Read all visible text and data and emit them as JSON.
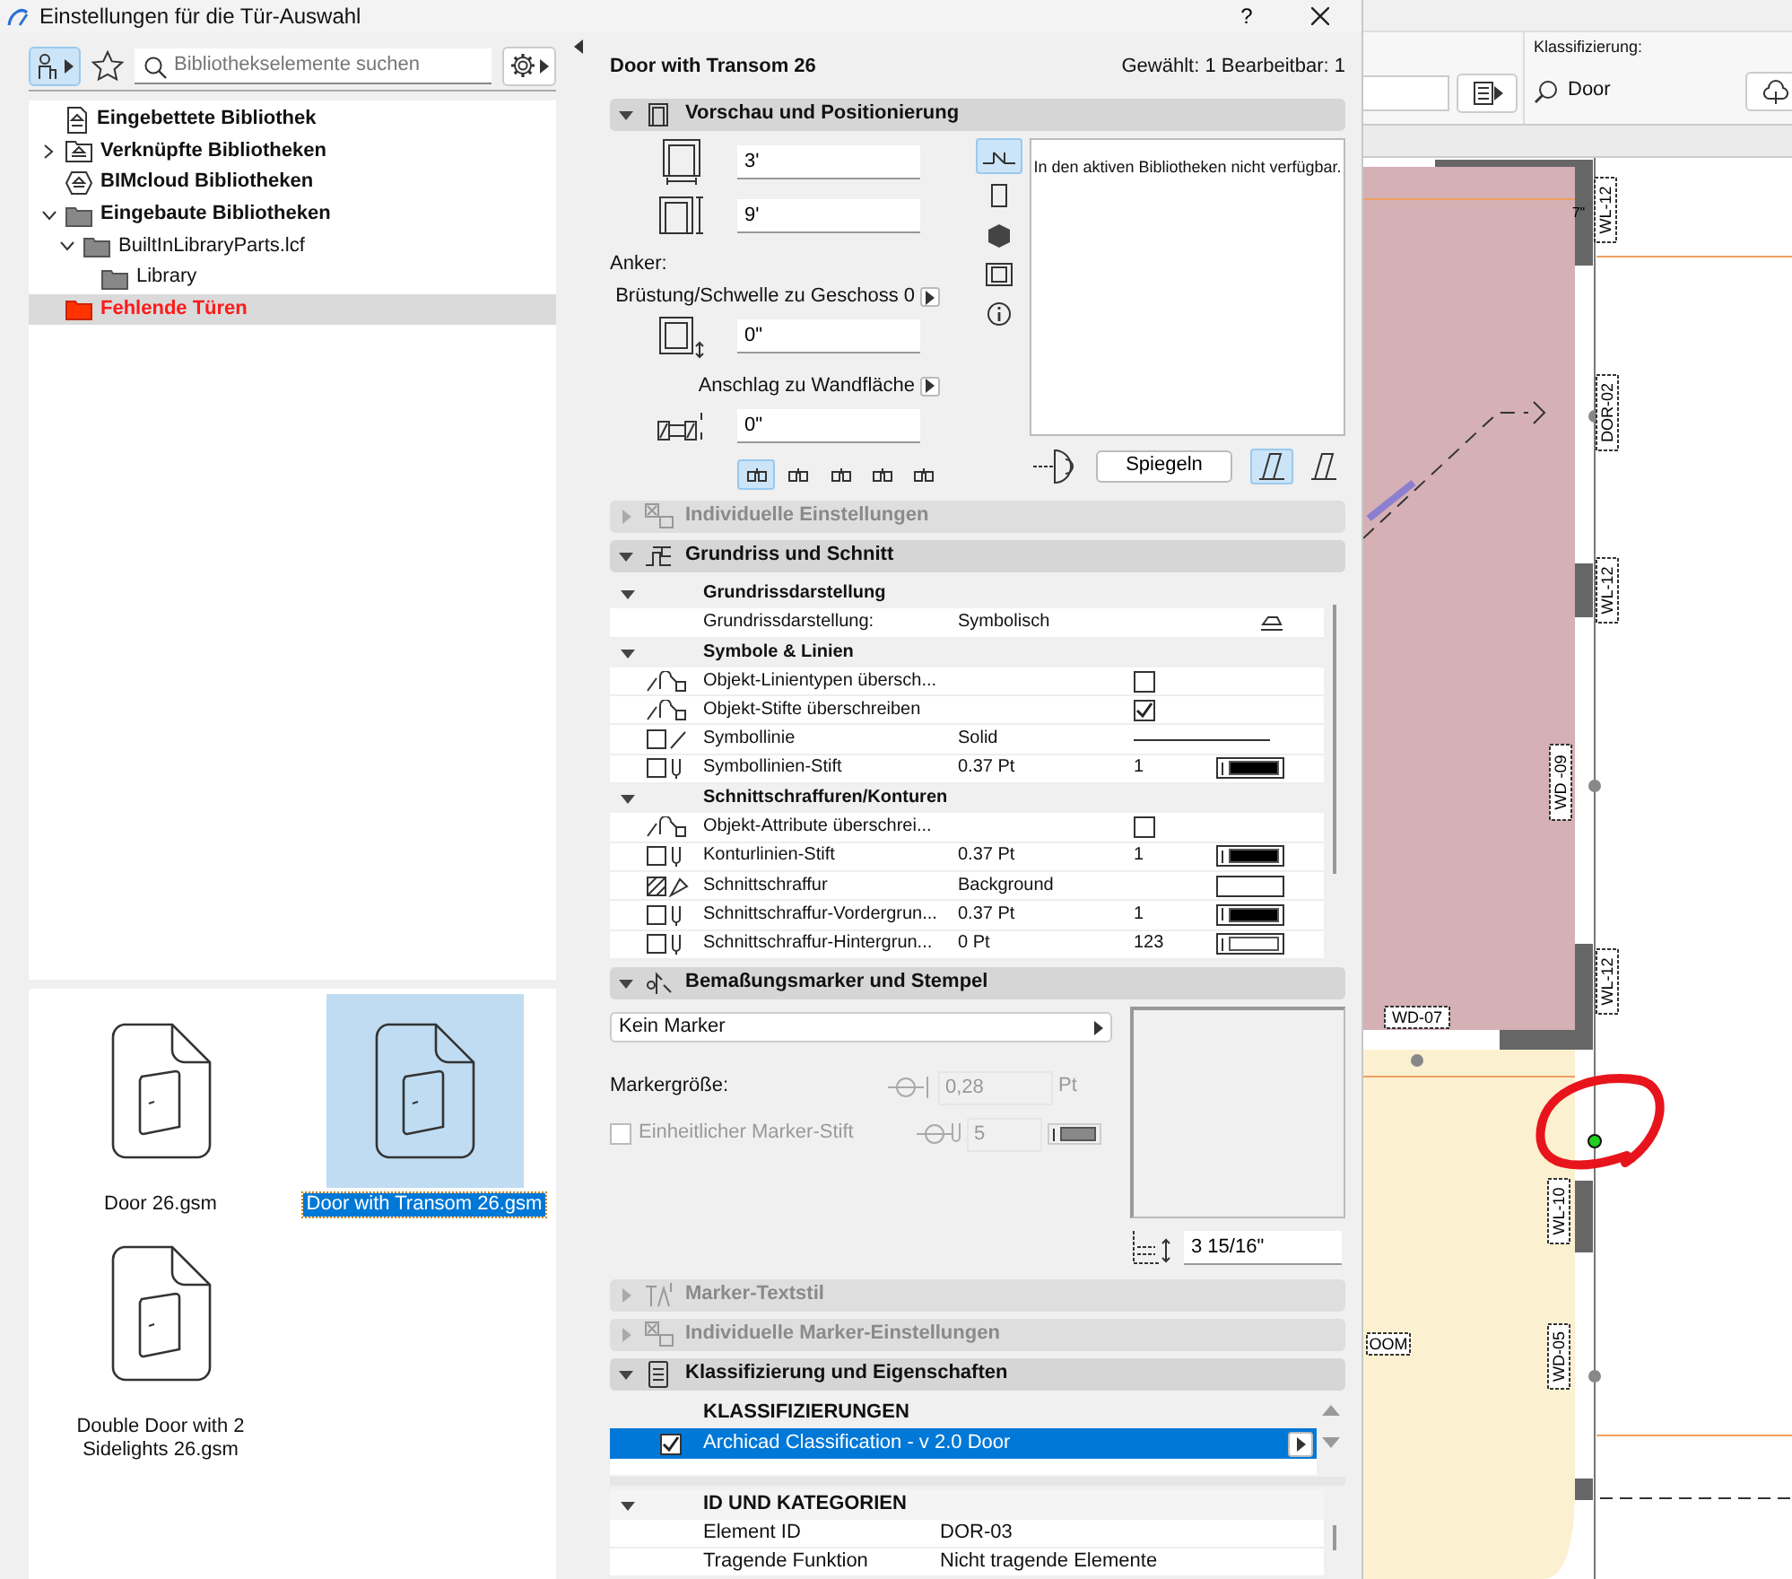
{
  "window": {
    "title": "Einstellungen für die Tür-Auswahl",
    "help": "?"
  },
  "library": {
    "type_button": {
      "active": true
    },
    "search": {
      "placeholder": "Bibliothekselemente suchen"
    },
    "tree": [
      {
        "label": "Eingebettete Bibliothek",
        "kind": "embedded",
        "selected": false
      },
      {
        "label": "Verknüpfte Bibliotheken",
        "kind": "linked",
        "expanded": false,
        "selected": false
      },
      {
        "label": "BIMcloud Bibliotheken",
        "kind": "bimcloud",
        "selected": false
      },
      {
        "label": "Eingebaute Bibliotheken",
        "kind": "folder",
        "expanded": true,
        "selected": false,
        "children": [
          {
            "label": "BuiltInLibraryParts.lcf",
            "kind": "folder",
            "expanded": true,
            "selected": false,
            "children": [
              {
                "label": "Library",
                "kind": "folder",
                "selected": false
              }
            ]
          }
        ]
      },
      {
        "label": "Fehlende Türen",
        "kind": "missing",
        "selected": true
      }
    ],
    "files": [
      {
        "name": "Door 26.gsm",
        "selected": false
      },
      {
        "name": "Door with Transom 26.gsm",
        "selected": true
      },
      {
        "name": "Double Door with 2 Sidelights 26.gsm",
        "selected": false
      }
    ]
  },
  "settings": {
    "element_name": "Door with Transom 26",
    "selection_info": "Gewählt: 1 Bearbeitbar: 1",
    "sections": [
      {
        "kind": "preview",
        "title": "Vorschau und Positionierung",
        "expanded": true,
        "disabled": false,
        "width": "3'",
        "height": "9'",
        "anchor_label": "Anker:",
        "sill_label": "Brüstung/Schwelle zu Geschoss 0",
        "sill_value": "0\"",
        "reveal_label": "Anschlag zu Wandfläche",
        "reveal_value": "0\"",
        "anchors": [
          {
            "selected": true
          },
          {
            "selected": false
          },
          {
            "selected": false
          },
          {
            "selected": false
          },
          {
            "selected": false
          }
        ],
        "views": [
          {
            "selected": true
          },
          {
            "selected": false
          },
          {
            "selected": false
          },
          {
            "selected": false
          },
          {
            "selected": false
          }
        ],
        "preview_message": "In den aktiven Bibliotheken nicht verfügbar.",
        "mirror_button": "Spiegeln",
        "sides": [
          {
            "selected": true
          },
          {
            "selected": false
          }
        ]
      },
      {
        "kind": "plain",
        "title": "Individuelle Einstellungen",
        "expanded": false,
        "disabled": true
      },
      {
        "kind": "table",
        "title": "Grundriss und Schnitt",
        "expanded": true,
        "disabled": false,
        "rows": [
          {
            "kind": "group",
            "label": "Grundrissdarstellung",
            "expanded": true
          },
          {
            "kind": "option",
            "label": "Grundrissdarstellung:",
            "value": "Symbolisch"
          },
          {
            "kind": "group",
            "label": "Symbole & Linien",
            "expanded": true
          },
          {
            "kind": "checkbox",
            "label": "Objekt-Linientypen übersch...",
            "checked": false
          },
          {
            "kind": "checkbox",
            "label": "Objekt-Stifte überschreiben",
            "checked": true
          },
          {
            "kind": "line",
            "label": "Symbollinie",
            "value": "Solid"
          },
          {
            "kind": "pen",
            "label": "Symbollinien-Stift",
            "value": "0.37 Pt",
            "pen": "1",
            "color": "#000000"
          },
          {
            "kind": "group",
            "label": "Schnittschraffuren/Konturen",
            "expanded": true
          },
          {
            "kind": "checkbox",
            "label": "Objekt-Attribute überschrei...",
            "checked": false
          },
          {
            "kind": "pen",
            "label": "Konturlinien-Stift",
            "value": "0.37 Pt",
            "pen": "1",
            "color": "#000000"
          },
          {
            "kind": "fill",
            "label": "Schnittschraffur",
            "value": "Background"
          },
          {
            "kind": "pen",
            "label": "Schnittschraffur-Vordergrun...",
            "value": "0.37 Pt",
            "pen": "1",
            "color": "#000000"
          },
          {
            "kind": "pen",
            "label": "Schnittschraffur-Hintergrun...",
            "value": "0 Pt",
            "pen": "123",
            "color": "#ffffff"
          }
        ]
      },
      {
        "kind": "marker",
        "title": "Bemaßungsmarker und Stempel",
        "expanded": true,
        "disabled": false,
        "marker_type": "Kein Marker",
        "size_label": "Markergröße:",
        "size_value": "0,28",
        "size_unit": "Pt",
        "pen_label": "Einheitlicher Marker-Stift",
        "pen_checked": false,
        "pen_disabled": true,
        "pen_value": "5",
        "offset_value": "3 15/16\""
      },
      {
        "kind": "plain",
        "title": "Marker-Textstil",
        "expanded": false,
        "disabled": true
      },
      {
        "kind": "plain",
        "title": "Individuelle Marker-Einstellungen",
        "expanded": false,
        "disabled": true
      },
      {
        "kind": "classification",
        "title": "Klassifizierung und Eigenschaften",
        "expanded": true,
        "disabled": false,
        "heading": "KLASSIFIZIERUNGEN",
        "classifications": [
          {
            "label": "Archicad Classification - v 2.0 Door",
            "checked": true,
            "selected": true
          }
        ],
        "groups": [
          {
            "label": "ID UND KATEGORIEN",
            "expanded": true,
            "rows": [
              {
                "label": "Element ID",
                "value": "DOR-03"
              },
              {
                "label": "Tragende Funktion",
                "value": "Nicht tragende Elemente"
              }
            ]
          }
        ]
      }
    ]
  },
  "plan": {
    "toolbar": {
      "classification_label": "Klassifizierung:",
      "classification_value": "Door"
    },
    "tags": [
      {
        "text": "7\"",
        "kind": "dimension"
      },
      {
        "text": "WL-12",
        "kind": "vertical"
      },
      {
        "text": "DOR-02",
        "kind": "vertical"
      },
      {
        "text": "WL-12",
        "kind": "vertical"
      },
      {
        "text": "WD -09",
        "kind": "vertical"
      },
      {
        "text": "WL-12",
        "kind": "vertical"
      },
      {
        "text": "WD-07",
        "kind": "horizontal"
      },
      {
        "text": "WL-10",
        "kind": "vertical"
      },
      {
        "text": "WD-05",
        "kind": "vertical"
      },
      {
        "text": "OOM",
        "kind": "horizontal"
      }
    ]
  }
}
